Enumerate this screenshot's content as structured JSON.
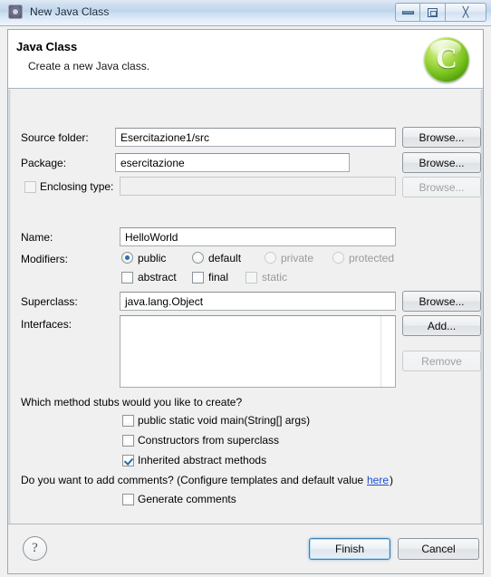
{
  "window": {
    "title": "New Java Class",
    "icon": "eclipse-app-icon",
    "controls": {
      "minimize": "minimize-button",
      "maximize": "maximize-button",
      "close": "╳"
    }
  },
  "header": {
    "title": "Java Class",
    "subtitle": "Create a new Java class.",
    "logo_letter": "C"
  },
  "form": {
    "source_folder": {
      "label": "Source folder:",
      "value": "Esercitazione1/src",
      "button": "Browse..."
    },
    "package": {
      "label": "Package:",
      "value": "esercitazione",
      "button": "Browse..."
    },
    "enclosing_type": {
      "label": "Enclosing type:",
      "value": "",
      "checked": false,
      "button": "Browse..."
    },
    "name": {
      "label": "Name:",
      "value": "HelloWorld"
    },
    "modifiers": {
      "label": "Modifiers:",
      "radios": [
        {
          "label": "public",
          "selected": true,
          "disabled": false
        },
        {
          "label": "default",
          "selected": false,
          "disabled": false
        },
        {
          "label": "private",
          "selected": false,
          "disabled": true
        },
        {
          "label": "protected",
          "selected": false,
          "disabled": true
        }
      ],
      "checkboxes": [
        {
          "label": "abstract",
          "checked": false,
          "disabled": false
        },
        {
          "label": "final",
          "checked": false,
          "disabled": false
        },
        {
          "label": "static",
          "checked": false,
          "disabled": true
        }
      ]
    },
    "superclass": {
      "label": "Superclass:",
      "value": "java.lang.Object",
      "button": "Browse..."
    },
    "interfaces": {
      "label": "Interfaces:",
      "items": [],
      "add_button": "Add...",
      "remove_button": "Remove"
    },
    "stubs": {
      "question": "Which method stubs would you like to create?",
      "options": [
        {
          "label": "public static void main(String[] args)",
          "checked": false
        },
        {
          "label": "Constructors from superclass",
          "checked": false
        },
        {
          "label": "Inherited abstract methods",
          "checked": true
        }
      ]
    },
    "comments": {
      "question_before": "Do you want to add comments? (Configure templates and default value ",
      "link": "here",
      "question_after": ")",
      "option": {
        "label": "Generate comments",
        "checked": false
      }
    }
  },
  "footer": {
    "help": "?",
    "finish": "Finish",
    "cancel": "Cancel"
  },
  "colors": {
    "accent": "#3c7fb1",
    "link": "#1a4fd0",
    "logo_green": "#76c11c",
    "disabled_text": "#9a9a9a"
  }
}
